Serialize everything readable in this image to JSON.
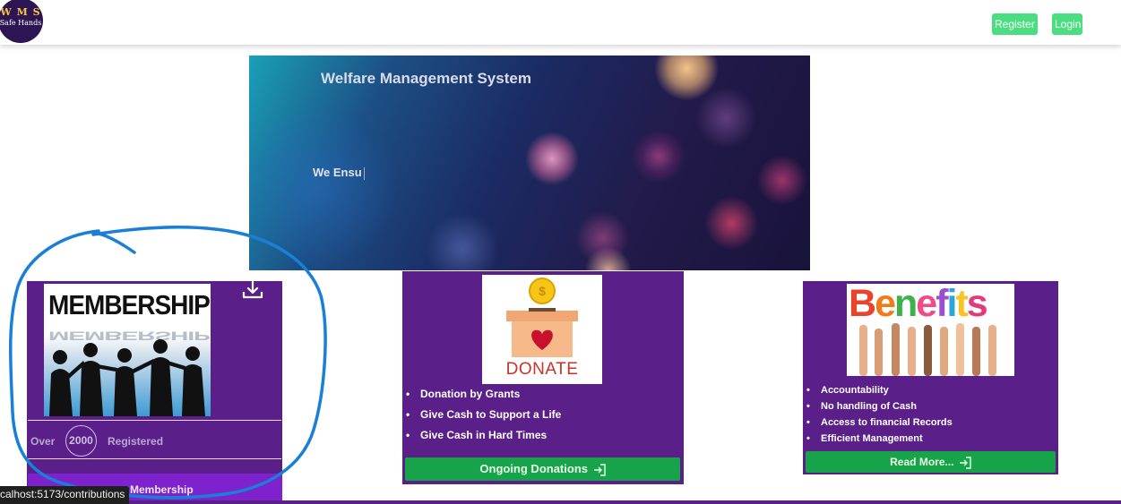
{
  "nav": {
    "logo_top": "W M S",
    "logo_bottom": "Safe Hands",
    "register_label": "Register",
    "login_label": "Login"
  },
  "hero": {
    "title": "Welfare Management System",
    "typing_text": "We Ensu"
  },
  "membership": {
    "image_text": "MEMBERSHIP",
    "over_label": "Over",
    "count": "2000",
    "registered_label": "Registered",
    "button_label": "Membership"
  },
  "donations": {
    "image_text": "DONATE",
    "items": [
      "Donation by Grants",
      "Give Cash to Support a Life",
      "Give Cash in Hard Times"
    ],
    "button_label": "Ongoing Donations"
  },
  "benefits": {
    "image_text": "Benefits",
    "items": [
      "Accountability",
      "No handling of Cash",
      "Access to financial Records",
      "Efficient Management"
    ],
    "button_label": "Read More..."
  },
  "status_bar": {
    "url": "calhost:5173/contributions"
  },
  "colors": {
    "card_purple": "#5b1f8a",
    "button_green": "#16a34a",
    "nav_green": "#4ade80",
    "annotation_blue": "#1a7fd6"
  }
}
